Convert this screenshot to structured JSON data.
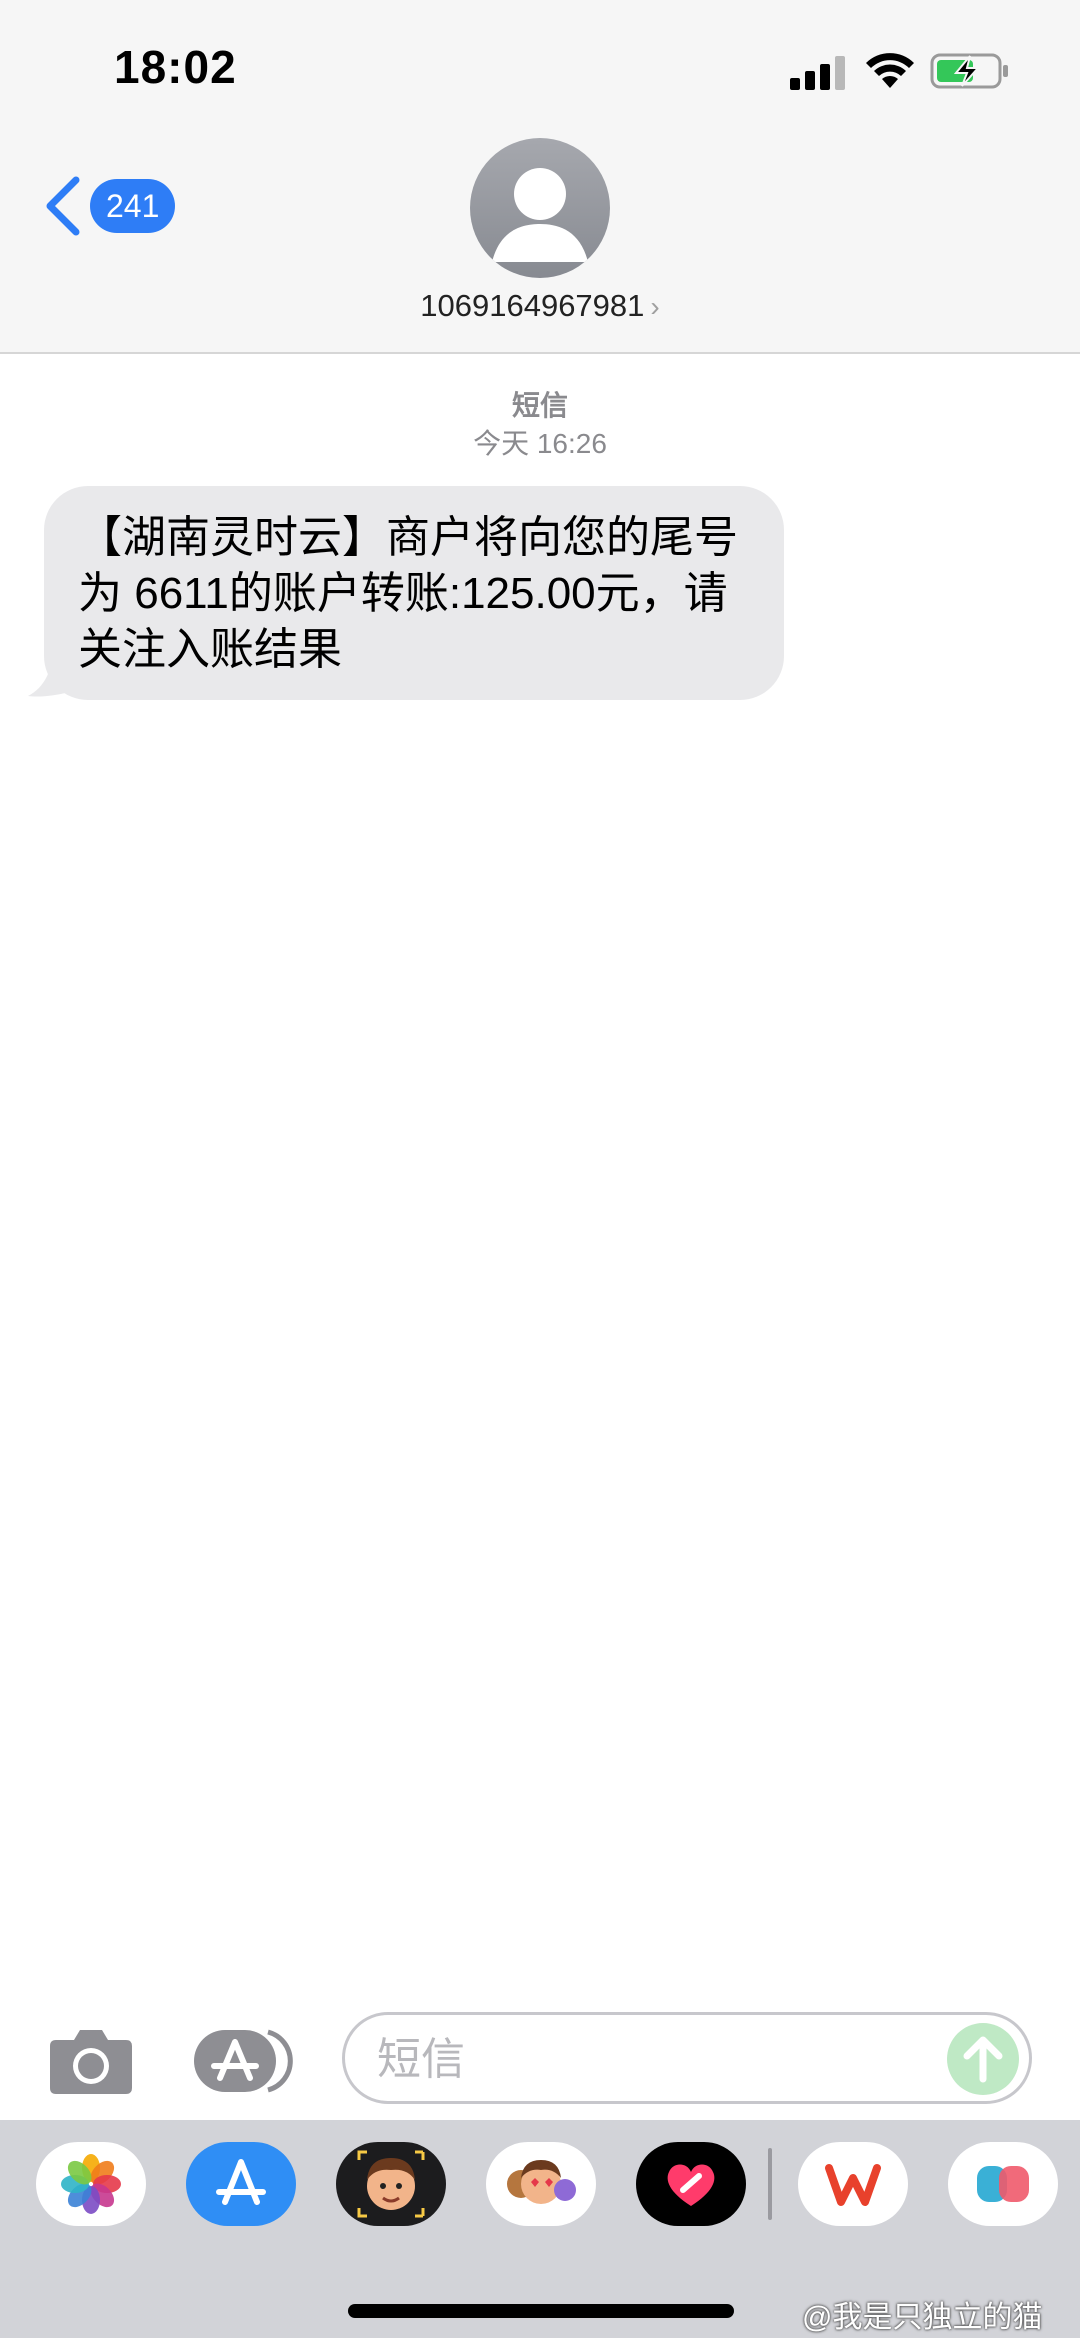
{
  "status_bar": {
    "time": "18:02"
  },
  "nav": {
    "back_count": "241",
    "contact_number": "1069164967981",
    "contact_chevron": "›"
  },
  "thread": {
    "service_label": "短信",
    "date_prefix": "今天",
    "time": "16:26",
    "message": "【湖南灵时云】商户将向您的尾号为 6611的账户转账:125.00元，请关注入账结果"
  },
  "composer": {
    "placeholder": "短信"
  },
  "drawer": {
    "apps": [
      "photos-icon",
      "app-store-icon",
      "memoji-stickers-icon",
      "animoji-icon",
      "digital-touch-icon",
      "wps-office-icon",
      "extra-app-icon"
    ]
  },
  "watermark": {
    "text": "@我是只独立的猫"
  },
  "colors": {
    "accent": "#2e7df6",
    "bubble": "#e9e9eb",
    "header_bg": "#f6f6f6",
    "send_button": "#bfe9c5",
    "drawer_bg": "#d2d3d8"
  }
}
